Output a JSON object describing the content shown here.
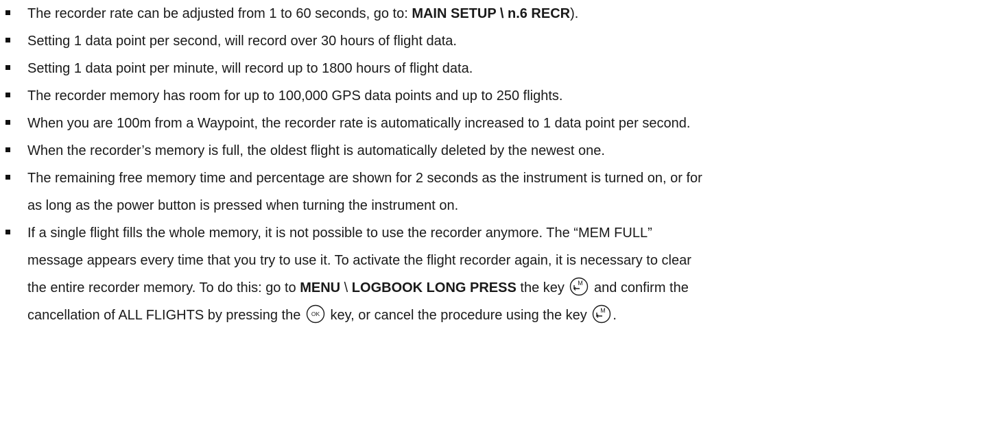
{
  "items": [
    {
      "text_before": "The recorder rate can be adjusted from 1 to 60 seconds, go to: ",
      "path": "MAIN SETUP \\ n.6  RECR",
      "text_after": ")."
    },
    {
      "text": "Setting 1 data point per second, will record over 30 hours of flight data."
    },
    {
      "text": "Setting 1 data point per minute, will record up to 1800 hours of flight data."
    },
    {
      "text": "The recorder memory has room for up to 100,000 GPS data points and up to 250 flights."
    },
    {
      "text": "When you are 100m from a Waypoint, the recorder rate is automatically increased to 1 data point per second."
    },
    {
      "text": "When the recorder’s memory is full, the oldest flight is automatically deleted by the newest one."
    },
    {
      "line1": "The remaining free memory time and percentage are shown for 2 seconds as the instrument is turned on, or for",
      "line2": "as long as the power button is pressed when turning the instrument on."
    },
    {
      "line1": "If a single flight fills the whole memory, it is not possible to use the recorder anymore. The “MEM FULL”",
      "line2": "message appears every time that you try to use it. To activate the flight recorder again, it is necessary to clear",
      "line3_a": "the entire recorder memory. To do this: go to ",
      "menu": "MENU",
      "sep": " \\ ",
      "logbook": "LOGBOOK LONG PRESS",
      "line3_b": " the key ",
      "line3_c": " and confirm the",
      "line4_a": "cancellation of ALL FLIGHTS by pressing the ",
      "line4_b": " key, or cancel the procedure using the key ",
      "line4_c": "."
    }
  ],
  "keys": {
    "m_key_label": "M",
    "ok_key_label": "OK"
  }
}
